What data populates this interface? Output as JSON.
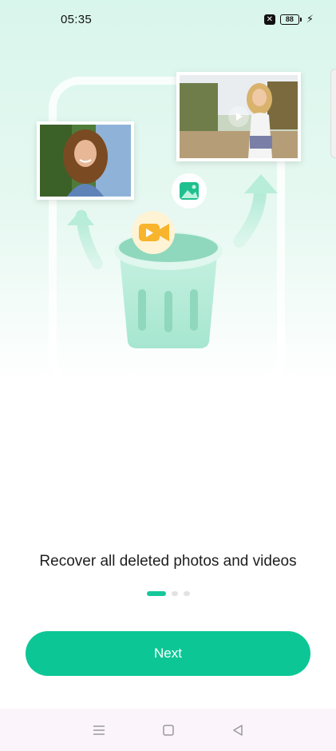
{
  "status_bar": {
    "time": "05:35",
    "battery": "88",
    "icons": [
      "sim-x-icon",
      "battery-icon",
      "charging-bolt-icon"
    ]
  },
  "onboarding": {
    "caption": "Recover all deleted photos and videos",
    "page_indicator": {
      "current": 1,
      "total": 3
    },
    "illustration_icons": [
      "trash-bin-icon",
      "gallery-icon",
      "video-camera-icon",
      "arrow-up-icon",
      "play-icon"
    ]
  },
  "actions": {
    "next_label": "Next"
  },
  "nav_bar": {
    "icons": [
      "menu-icon",
      "home-icon",
      "back-icon"
    ]
  },
  "colors": {
    "accent": "#0cc795",
    "hero_background": "#d9f6ec",
    "trash_color": "#b6ecd9",
    "video_badge": "#f7b42c"
  }
}
